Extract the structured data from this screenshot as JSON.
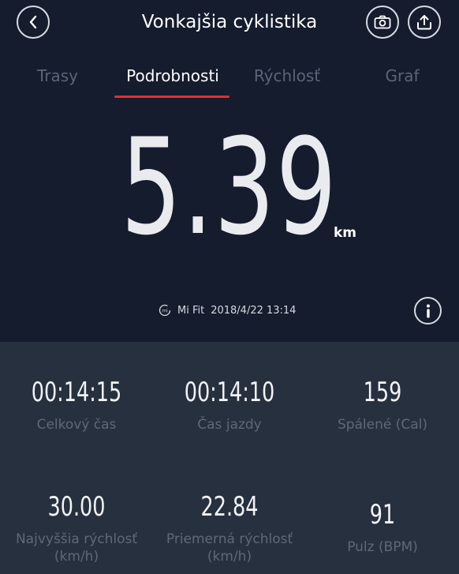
{
  "header": {
    "title": "Vonkajšia cyklistika"
  },
  "tabs": [
    {
      "label": "Trasy",
      "active": false
    },
    {
      "label": "Podrobnosti",
      "active": true
    },
    {
      "label": "Rýchlosť",
      "active": false
    },
    {
      "label": "Graf",
      "active": false
    }
  ],
  "summary": {
    "distance": "5.39",
    "unit": "km",
    "source_app": "Mi Fit",
    "datetime": "2018/4/22 13:14"
  },
  "stats": [
    {
      "value": "00:14:15",
      "label": "Celkový čas"
    },
    {
      "value": "00:14:10",
      "label": "Čas jazdy"
    },
    {
      "value": "159",
      "label": "Spálené (Cal)"
    },
    {
      "value": "30.00",
      "label": "Najvyššia rýchlosť (km/h)"
    },
    {
      "value": "22.84",
      "label": "Priemerná rýchlosť (km/h)"
    },
    {
      "value": "91",
      "label": "Pulz (BPM)"
    }
  ],
  "colors": {
    "background": "#151c2e",
    "stats_background": "#27303f",
    "accent": "#e03030",
    "inactive_text": "#5b6476"
  },
  "icons": {
    "back": "chevron-left-icon",
    "camera": "camera-icon",
    "share": "upload-icon",
    "source": "mi-fit-icon",
    "info": "info-icon"
  }
}
